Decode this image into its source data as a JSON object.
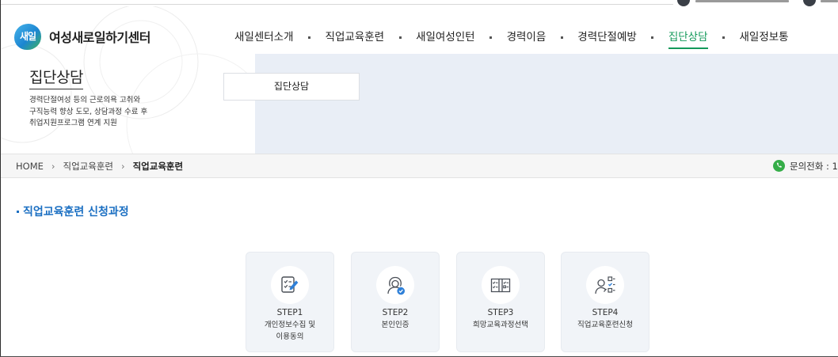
{
  "header": {
    "logo_mark": "새일",
    "logo_text": "여성새로일하기센터",
    "nav": [
      {
        "label": "새일센터소개",
        "active": false
      },
      {
        "label": "직업교육훈련",
        "active": false
      },
      {
        "label": "새일여성인턴",
        "active": false
      },
      {
        "label": "경력이음",
        "active": false
      },
      {
        "label": "경력단절예방",
        "active": false
      },
      {
        "label": "집단상담",
        "active": true
      },
      {
        "label": "새일정보통",
        "active": false
      }
    ]
  },
  "banner": {
    "title": "집단상담",
    "description": [
      "경력단절여성 등의 근로의욕 고취와",
      "구직능력 향상 도모, 상담과정 수료 후",
      "취업지원프로그램 연계 지원"
    ],
    "tab_label": "집단상담"
  },
  "breadcrumb": {
    "items": [
      "HOME",
      "직업교육훈련",
      "직업교육훈련"
    ],
    "separator": "›"
  },
  "contact": {
    "icon": "phone-icon",
    "label": "문의전화 : 1"
  },
  "section": {
    "title": "직업교육훈련 신청과정"
  },
  "steps": [
    {
      "step": "STEP1",
      "lines": [
        "개인정보수집 및",
        "이용동의"
      ],
      "icon": "document-checklist-pen-icon"
    },
    {
      "step": "STEP2",
      "lines": [
        "본인인증"
      ],
      "icon": "user-verified-icon"
    },
    {
      "step": "STEP3",
      "lines": [
        "희망교육과정선택"
      ],
      "icon": "book-checklist-icon"
    },
    {
      "step": "STEP4",
      "lines": [
        "직업교육훈련신청"
      ],
      "icon": "user-checklist-icon"
    }
  ],
  "colors": {
    "accent_green": "#13995a",
    "link_blue": "#1b6fc2",
    "banner_bg": "#e9eef6",
    "card_bg": "#f1f4f8",
    "icon_accent": "#2f80d8",
    "phone_green": "#35ad48"
  }
}
